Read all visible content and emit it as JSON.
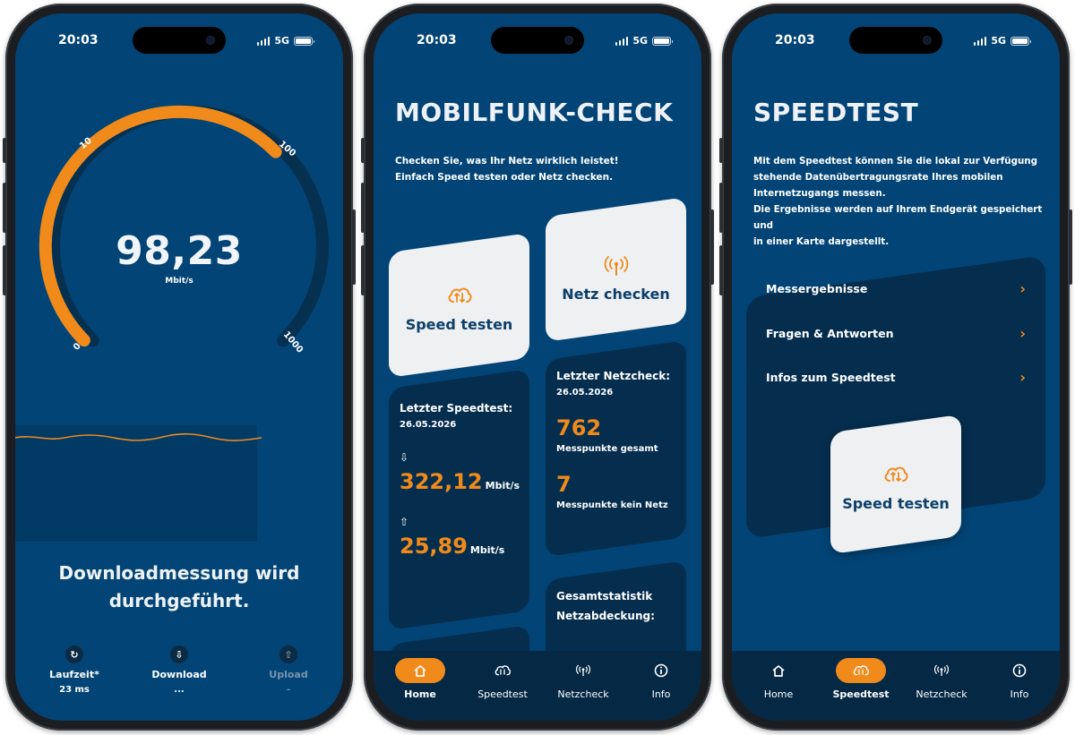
{
  "status": {
    "time": "20:03",
    "network": "5G"
  },
  "screen1": {
    "gauge_ticks": [
      "0",
      "10",
      "100",
      "1000"
    ],
    "speed_value": "98,23",
    "speed_unit": "Mbit/s",
    "progress_fraction": 0.67,
    "message": "Downloadmessung wird durchgeführt.",
    "metrics": [
      {
        "label": "Laufzeit*",
        "value": "23 ms",
        "icon": "refresh-icon"
      },
      {
        "label": "Download",
        "value": "...",
        "icon": "cloud-download-icon"
      },
      {
        "label": "Upload",
        "value": "-",
        "icon": "cloud-upload-icon"
      }
    ]
  },
  "screen2": {
    "title": "MOBILFUNK-CHECK",
    "intro_line1": "Checken Sie, was Ihr Netz wirklich leistet!",
    "intro_line2": "Einfach Speed testen oder Netz checken.",
    "speed_button": "Speed testen",
    "net_button": "Netz checken",
    "last_speedtest": {
      "label": "Letzter Speedtest:",
      "date": "26.05.2026",
      "download": "322,12",
      "upload": "25,89",
      "unit": "Mbit/s"
    },
    "last_netcheck": {
      "label": "Letzter Netzcheck:",
      "date": "26.05.2026",
      "total": "762",
      "total_label": "Messpunkte gesamt",
      "no_signal": "7",
      "no_signal_label": "Messpunkte kein Netz"
    },
    "stats_title_line1": "Gesamtstatistik",
    "stats_title_line2": "Netzabdeckung:"
  },
  "screen3": {
    "title": "SPEEDTEST",
    "intro": [
      "Mit dem Speedtest können Sie die lokal zur Verfügung",
      "stehende Datenübertragungsrate Ihres mobilen",
      "Internetzugangs messen.",
      "Die Ergebnisse werden auf Ihrem Endgerät gespeichert und",
      "in einer Karte dargestellt."
    ],
    "menu": [
      "Messergebnisse",
      "Fragen & Antworten",
      "Infos zum Speedtest"
    ],
    "speed_button": "Speed testen"
  },
  "tabs": [
    {
      "label": "Home",
      "icon": "home-icon"
    },
    {
      "label": "Speedtest",
      "icon": "cloud-speed-icon"
    },
    {
      "label": "Netzcheck",
      "icon": "antenna-icon"
    },
    {
      "label": "Info",
      "icon": "info-icon"
    }
  ],
  "colors": {
    "background": "#024476",
    "accent": "#f08a1b",
    "card_light": "#eef0f2",
    "card_dark": "#052d4e"
  }
}
